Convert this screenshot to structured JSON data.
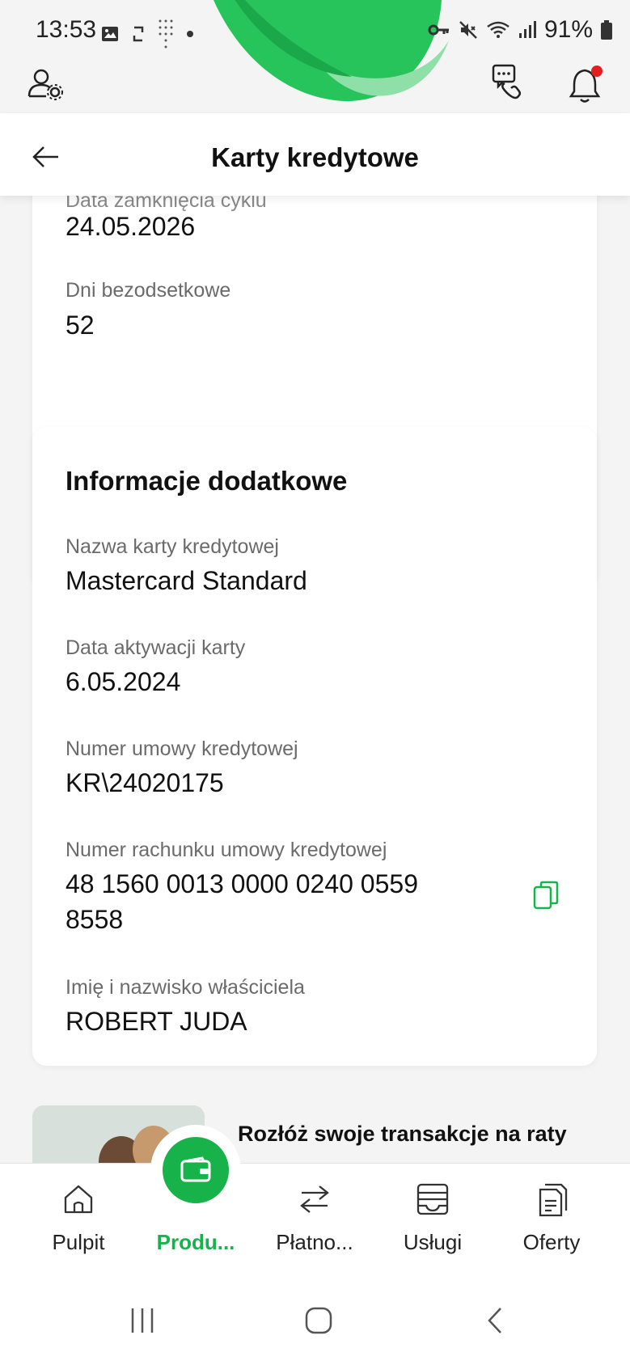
{
  "status_bar": {
    "time": "13:53",
    "battery": "91%",
    "left_icons": [
      "image-icon",
      "sync-icon",
      "dots-grid-icon",
      "dot-icon"
    ],
    "right_icons": [
      "key-icon",
      "mute-icon",
      "wifi-icon",
      "signal-icon",
      "battery-icon"
    ]
  },
  "top_bar": {
    "profile_settings_icon": "user-settings-icon",
    "contact_icon": "chat-phone-icon",
    "notifications_icon": "bell-icon",
    "notification_dot_color": "#e41e1e"
  },
  "header": {
    "title": "Karty kredytowe",
    "back_icon": "arrow-left-icon"
  },
  "card_cycle": {
    "partial_label": "Data zamknięcia cyklu",
    "partial_value": "24.05.2026",
    "interest_free_label": "Dni bezodsetkowe",
    "interest_free_value": "52"
  },
  "card_info": {
    "title": "Informacje dodatkowe",
    "fields": [
      {
        "label": "Nazwa karty kredytowej",
        "value": "Mastercard Standard"
      },
      {
        "label": "Data aktywacji karty",
        "value": "6.05.2024"
      },
      {
        "label": "Numer umowy kredytowej",
        "value": "KR\\24020175"
      },
      {
        "label": "Numer rachunku umowy kredytowej",
        "value_line1": "48 1560 0013 0000 0240 0559",
        "value_line2": "8558"
      },
      {
        "label": "Imię i nazwisko właściciela",
        "value": "ROBERT JUDA"
      }
    ],
    "copy_icon": "copy-icon"
  },
  "promo": {
    "title": "Rozłóż swoje transakcje na raty"
  },
  "bottom_nav": {
    "items": [
      {
        "label": "Pulpit",
        "icon": "home-icon"
      },
      {
        "label": "Produ...",
        "icon": "wallet-icon",
        "active": true
      },
      {
        "label": "Płatno...",
        "icon": "transfer-arrows-icon"
      },
      {
        "label": "Usługi",
        "icon": "tray-icon"
      },
      {
        "label": "Oferty",
        "icon": "documents-icon"
      }
    ]
  },
  "system_nav": {
    "icons": [
      "recent-apps-icon",
      "home-circle-icon",
      "back-chevron-icon"
    ]
  },
  "colors": {
    "accent": "#17b24a",
    "notification": "#e41e1e",
    "background": "#f4f4f4"
  }
}
